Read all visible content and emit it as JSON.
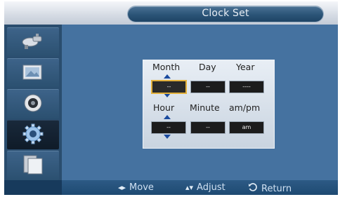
{
  "title": "Clock Set",
  "sidebar": {
    "items": [
      {
        "icon": "satellite-dish-icon",
        "active": false
      },
      {
        "icon": "picture-icon",
        "active": false
      },
      {
        "icon": "speaker-icon",
        "active": false
      },
      {
        "icon": "gear-icon",
        "active": true
      },
      {
        "icon": "multi-screen-icon",
        "active": false
      }
    ]
  },
  "date_section": {
    "month_label": "Month",
    "day_label": "Day",
    "year_label": "Year",
    "month_value": "--",
    "day_value": "--",
    "year_value": "----"
  },
  "time_section": {
    "hour_label": "Hour",
    "minute_label": "Minute",
    "ampm_label": "am/pm",
    "hour_value": "--",
    "minute_value": "--",
    "ampm_value": "am"
  },
  "footer": {
    "move_label": "Move",
    "adjust_label": "Adjust",
    "return_label": "Return"
  },
  "colors": {
    "accent_focus": "#e3b13b",
    "arrow": "#1a4a9e",
    "panel": "#4572a0"
  }
}
